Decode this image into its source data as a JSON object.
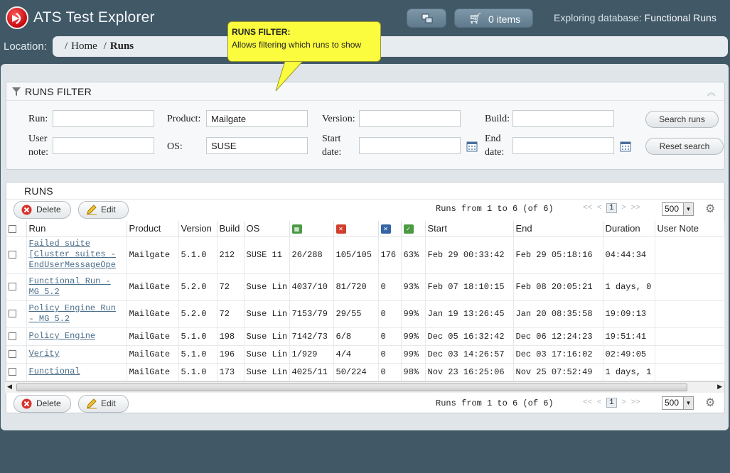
{
  "app": {
    "title": "ATS Test Explorer",
    "cart_label": "0 items",
    "exploring_label": "Exploring database:",
    "database_name": "Functional Runs"
  },
  "location": {
    "label": "Location:",
    "crumbs": [
      "Home",
      "Runs"
    ]
  },
  "callout": {
    "title": "RUNS FILTER:",
    "text": "Allows filtering which runs to show"
  },
  "filter": {
    "title": "RUNS FILTER",
    "run_label": "Run:",
    "run_value": "",
    "product_label": "Product:",
    "product_value": "Mailgate",
    "version_label": "Version:",
    "version_value": "",
    "build_label": "Build:",
    "build_value": "",
    "user_note_label_1": "User",
    "user_note_label_2": "note:",
    "user_note_value": "",
    "os_label": "OS:",
    "os_value": "SUSE",
    "start_date_label_1": "Start",
    "start_date_label_2": "date:",
    "start_date_value": "",
    "end_date_label_1": "End",
    "end_date_label_2": "date:",
    "end_date_value": "",
    "search_button": "Search runs",
    "reset_button": "Reset search"
  },
  "runs": {
    "title": "RUNS",
    "delete_label": "Delete",
    "edit_label": "Edit",
    "pager_info": "Runs from 1 to 6 (of 6)",
    "pager_first": "<<",
    "pager_prev": "<",
    "pager_page": "1",
    "pager_next": ">",
    "pager_last": ">>",
    "page_size": "500",
    "columns": [
      "Run",
      "Product",
      "Version",
      "Build",
      "OS",
      "",
      "",
      "",
      "",
      "Start",
      "End",
      "Duration",
      "User Note"
    ],
    "rows": [
      {
        "run": "Failed suite [Cluster suites - EndUserMessageOpe",
        "product": "Mailgate",
        "version": "5.1.0",
        "build": "212",
        "os": "SUSE 11",
        "tests": "26/288",
        "failed": "105/105",
        "c3": "176",
        "pct": "63%",
        "start": "Feb 29 00:33:42",
        "end": "Feb 29 05:18:16",
        "duration": "04:44:34",
        "note": ""
      },
      {
        "run": "Functional Run - MG 5.2",
        "product": "MailGate",
        "version": "5.2.0",
        "build": "72",
        "os": "Suse Lin",
        "tests": "4037/10",
        "failed": "81/720",
        "c3": "0",
        "pct": "93%",
        "start": "Feb 07 18:10:15",
        "end": "Feb 08 20:05:21",
        "duration": "1 days, 0",
        "note": ""
      },
      {
        "run": "Policy Engine Run - MG 5.2",
        "product": "MailGate",
        "version": "5.2.0",
        "build": "72",
        "os": "Suse Lin",
        "tests": "7153/79",
        "failed": "29/55",
        "c3": "0",
        "pct": "99%",
        "start": "Jan 19 13:26:45",
        "end": "Jan 20 08:35:58",
        "duration": "19:09:13",
        "note": ""
      },
      {
        "run": "Policy Engine",
        "product": "MailGate",
        "version": "5.1.0",
        "build": "198",
        "os": "Suse Lin",
        "tests": "7142/73",
        "failed": "6/8",
        "c3": "0",
        "pct": "99%",
        "start": "Dec 05 16:32:42",
        "end": "Dec 06 12:24:23",
        "duration": "19:51:41",
        "note": ""
      },
      {
        "run": "Verity",
        "product": "MailGate",
        "version": "5.1.0",
        "build": "196",
        "os": "Suse Lin",
        "tests": "1/929",
        "failed": "4/4",
        "c3": "0",
        "pct": "99%",
        "start": "Dec 03 14:26:57",
        "end": "Dec 03 17:16:02",
        "duration": "02:49:05",
        "note": ""
      },
      {
        "run": "Functional",
        "product": "MailGate",
        "version": "5.1.0",
        "build": "173",
        "os": "Suse Lin",
        "tests": "4025/11",
        "failed": "50/224",
        "c3": "0",
        "pct": "98%",
        "start": "Nov 23 16:25:06",
        "end": "Nov 25 07:52:49",
        "duration": "1 days, 1",
        "note": ""
      }
    ]
  },
  "colors": {
    "background": "#415867",
    "panel": "#dfe5e9",
    "callout": "#fcfc3f",
    "link": "#4b6e8a"
  },
  "icons": [
    "logo-icon",
    "database-icon",
    "cart-icon",
    "funnel-icon",
    "collapse-icon",
    "calendar-icon",
    "delete-icon",
    "edit-icon",
    "settings-gear-icon"
  ]
}
